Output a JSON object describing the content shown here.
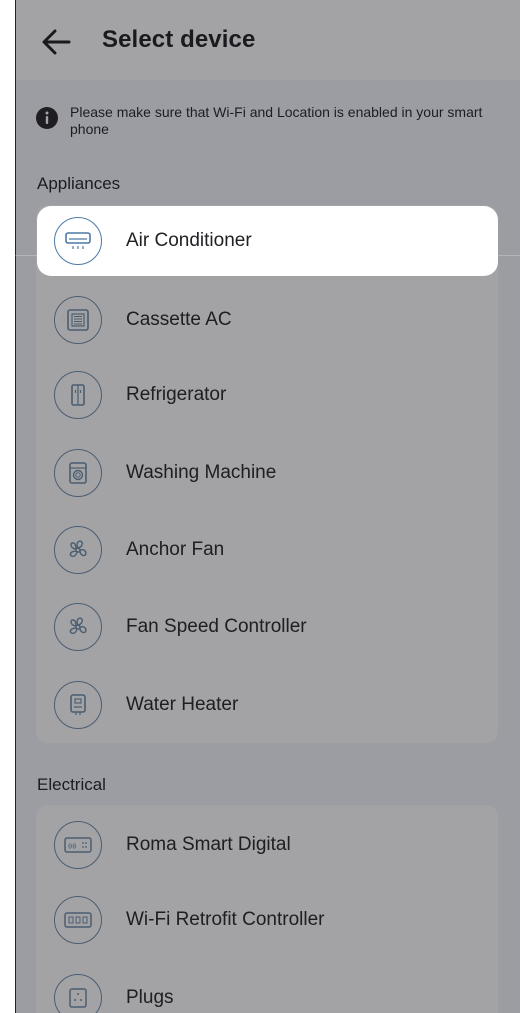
{
  "header": {
    "title": "Select device",
    "back_icon": "arrow-left-icon"
  },
  "notice": {
    "icon": "info-icon",
    "text": "Please make sure that Wi-Fi and Location is enabled in your smart phone"
  },
  "sections": [
    {
      "label": "Appliances",
      "items": [
        {
          "label": "Air Conditioner",
          "icon": "air-conditioner-icon"
        },
        {
          "label": "Cassette AC",
          "icon": "cassette-ac-icon"
        },
        {
          "label": "Refrigerator",
          "icon": "refrigerator-icon"
        },
        {
          "label": "Washing Machine",
          "icon": "washing-machine-icon"
        },
        {
          "label": "Anchor Fan",
          "icon": "fan-icon"
        },
        {
          "label": "Fan Speed Controller",
          "icon": "fan-icon"
        },
        {
          "label": "Water Heater",
          "icon": "water-heater-icon"
        }
      ]
    },
    {
      "label": "Electrical",
      "items": [
        {
          "label": "Roma Smart Digital",
          "icon": "digital-switch-icon"
        },
        {
          "label": "Wi-Fi Retrofit Controller",
          "icon": "retrofit-controller-icon"
        },
        {
          "label": "Plugs",
          "icon": "plug-icon"
        }
      ]
    }
  ],
  "colors": {
    "accent": "#4e79a7",
    "scrim": "#181a20"
  }
}
